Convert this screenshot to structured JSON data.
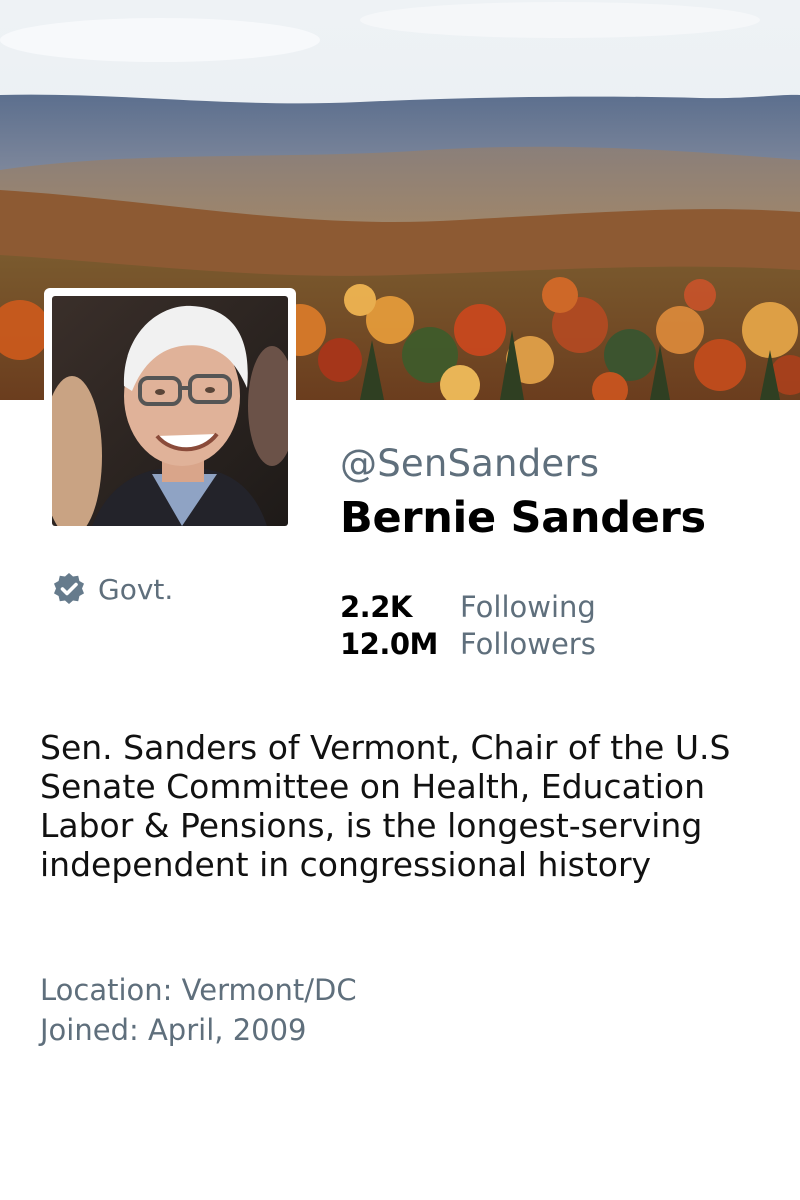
{
  "banner": {
    "description_icon": "landscape-photo"
  },
  "profile": {
    "avatar_icon": "profile-photo",
    "handle": "@SenSanders",
    "name": "Bernie Sanders",
    "badge": {
      "icon": "verified-badge-icon",
      "label": "Govt.",
      "color": "#667b8c"
    },
    "stats": [
      {
        "value": "2.2K",
        "label": "Following"
      },
      {
        "value": "12.0M",
        "label": "Followers"
      }
    ],
    "bio": "Sen. Sanders of Vermont, Chair of the U.S Senate Committee on Health, Education Labor & Pensions, is the longest-serving independent in congressional history",
    "location": "Location: Vermont/DC",
    "joined": "Joined: April, 2009"
  },
  "colors": {
    "text_primary": "#000000",
    "text_secondary": "#5f6f7c"
  }
}
